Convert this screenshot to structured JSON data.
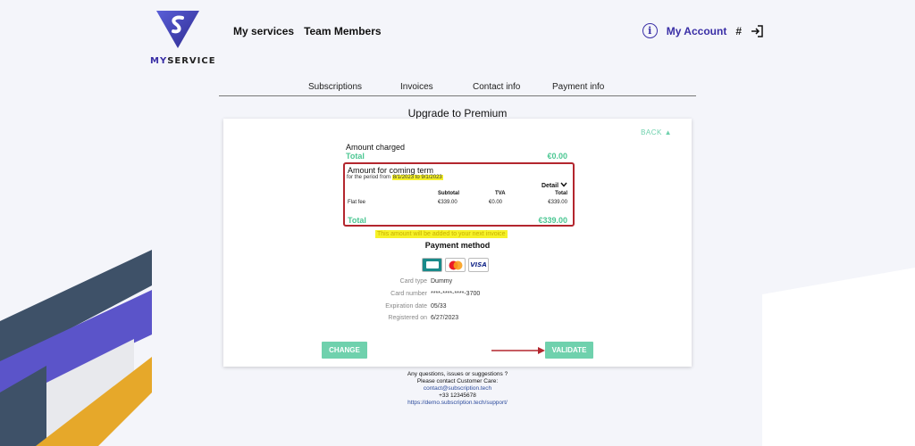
{
  "brand": {
    "name_prefix": "MY",
    "name_suffix": "SERVICE",
    "accent": "#3a2fa6",
    "green": "#6fd1ad"
  },
  "nav": {
    "items": [
      "My services",
      "Team Members"
    ]
  },
  "account": {
    "info_glyph": "i",
    "label": "My Account",
    "hash": "#"
  },
  "tabs": [
    "Subscriptions",
    "Invoices",
    "Contact info",
    "Payment info"
  ],
  "page_title": "Upgrade to Premium",
  "card": {
    "back_label": "BACK ▲",
    "amount_charged_label": "Amount charged",
    "charged_total_label": "Total",
    "charged_total_value": "€0.00",
    "term": {
      "title": "Amount for coming term",
      "period_prefix": "for the period from",
      "period_range": "8/1/2023 to 9/1/2023",
      "detail_label": "Detail",
      "columns": [
        "Subtotal",
        "TVA",
        "Total"
      ],
      "row": {
        "label": "Flat fee",
        "subtotal": "€339.00",
        "tva": "€0.00",
        "total": "€339.00"
      },
      "total_label": "Total",
      "total_value": "€339.00"
    },
    "note": "This amount will be added to your next invoice",
    "payment_method_title": "Payment method",
    "payment_icons": [
      "cb-card-icon",
      "mastercard-icon",
      "visa-icon"
    ],
    "visa_text": "VISA",
    "details": [
      {
        "key": "Card type",
        "value": "Dummy"
      },
      {
        "key": "Card number",
        "value": "****-****-****-3700"
      },
      {
        "key": "Expiration date",
        "value": "05/33"
      },
      {
        "key": "Registered on",
        "value": "6/27/2023"
      }
    ],
    "change_label": "CHANGE",
    "validate_label": "VALIDATE"
  },
  "footer": {
    "line1": "Any questions, issues or suggestions ?",
    "line2": "Please contact Customer Care:",
    "email": "contact@subscription.tech",
    "phone": "+33 12345678",
    "support_url": "https://demo.subscription.tech/support/"
  }
}
